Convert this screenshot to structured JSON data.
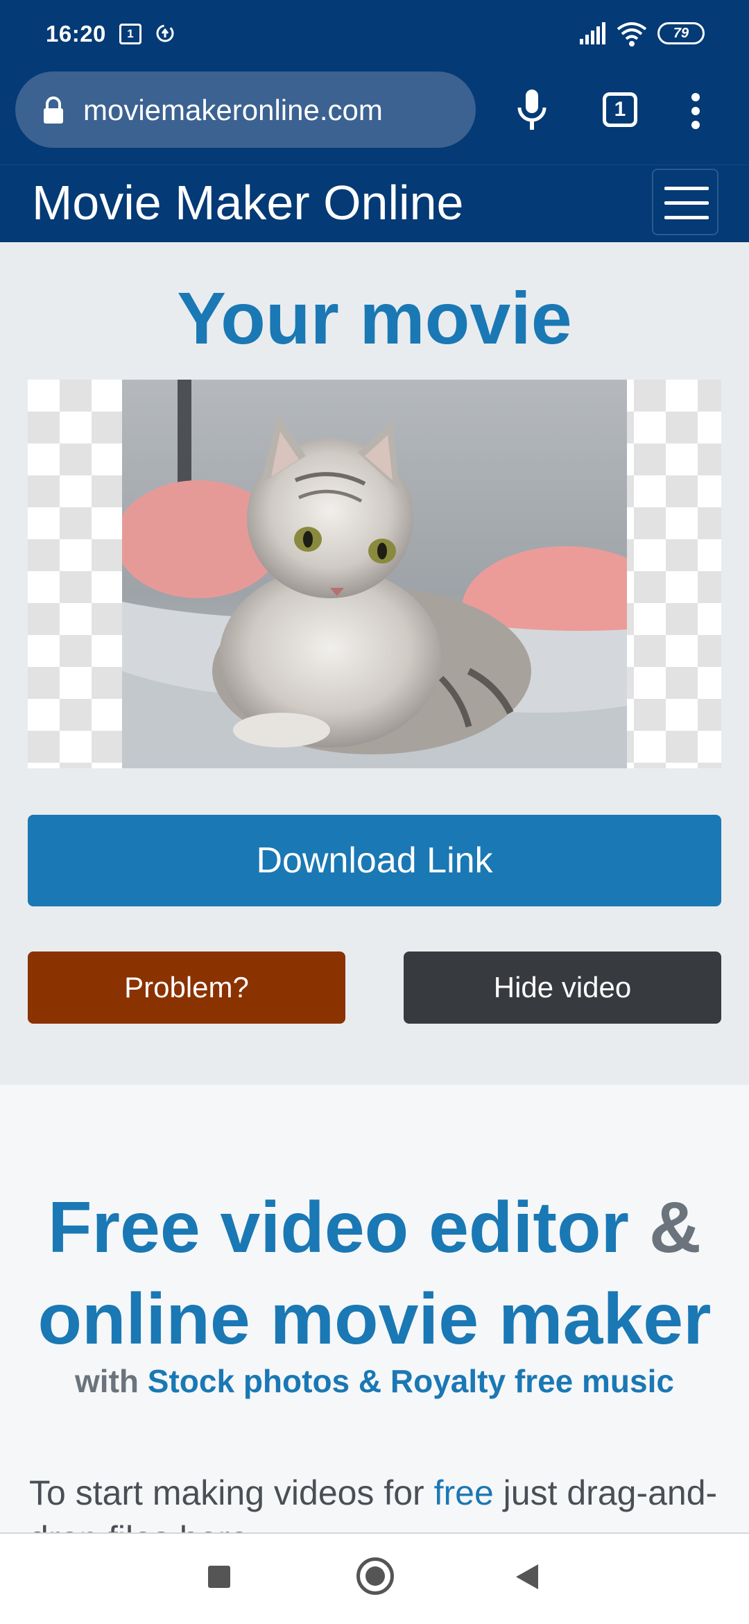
{
  "status_bar": {
    "time": "16:20",
    "sim_label": "1",
    "battery": "79",
    "icons": [
      "sim-icon",
      "sync-icon",
      "signal-icon",
      "wifi-icon",
      "battery-icon"
    ]
  },
  "browser": {
    "url": "moviemakeronline.com",
    "tab_count": "1",
    "icons": [
      "lock-icon",
      "mic-icon",
      "tabs-icon",
      "menu-dots-icon"
    ]
  },
  "site": {
    "brand": "Movie Maker Online",
    "menu_icon": "hamburger-icon"
  },
  "movie": {
    "title": "Your movie",
    "download_label": "Download Link",
    "problem_label": "Problem?",
    "hide_label": "Hide video"
  },
  "intro": {
    "heading_part1": "Free video editor",
    "heading_amp": "&",
    "heading_part2": "online movie maker",
    "sub_prefix": "with",
    "sub_link": "Stock photos & Royalty free music",
    "para_prefix": "To start making videos for",
    "para_link": "free",
    "para_suffix": "just drag-and-drop files here"
  },
  "colors": {
    "header_bg": "#043a75",
    "accent": "#1a78b4",
    "problem_button": "#8a3200",
    "hide_button": "#373a3f"
  }
}
